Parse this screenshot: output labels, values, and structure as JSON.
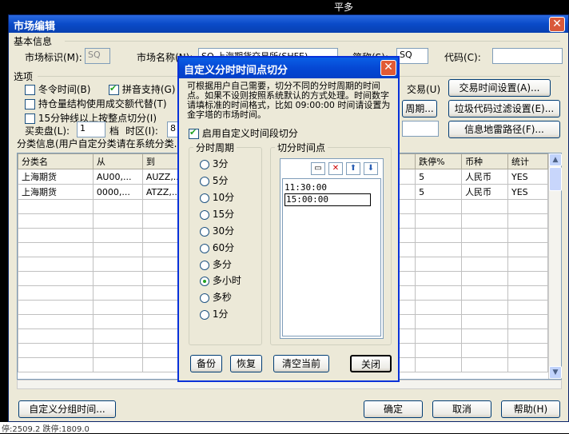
{
  "background": {
    "top_text": "平多",
    "bottom_text": "停:2509.2 跌停:1809.0"
  },
  "window": {
    "title": "市场编辑",
    "close_glyph": "✕",
    "basic_info": {
      "legend": "基本信息",
      "market_id_label": "市场标识(M):",
      "market_id_value": "SQ",
      "market_name_label": "市场名称(N):",
      "market_name_value": "SQ 上海期货交易所(SHFE)",
      "abbr_label": "简称(S):",
      "abbr_value": "SQ",
      "code_label": "代码(C):",
      "code_value": ""
    },
    "options": {
      "legend": "选项",
      "realtime_label": "冬令时间(B)",
      "realtime_checked": false,
      "pinyin_label": "拼音支持(G)",
      "pinyin_checked": true,
      "position_label": "持仓量结构使用成交额代替(T)",
      "position_checked": false,
      "min15_label": "15分钟线以上按整点切分(I)",
      "min15_checked": false,
      "buy_label": "买卖盘(L):",
      "buy_value": "1",
      "level_label": "档",
      "tz_label": "时区(I):",
      "tz_value": "8",
      "trade_label": "交易(U)",
      "trade_time_btn": "交易时间设置(A)...",
      "cycle_btn": "周期...",
      "filter_btn": "垃圾代码过滤设置(E)...",
      "info_btn": "信息地雷路径(F)..."
    },
    "category": {
      "legend": "分类信息(用户自定分类请在系统分类...",
      "columns": [
        "分类名",
        "从",
        "到",
        "",
        "跌停%",
        "币种",
        "统计"
      ],
      "rows": [
        [
          "上海期货",
          "AU00,...",
          "AUZZ,...",
          "",
          "5",
          "人民币",
          "YES"
        ],
        [
          "上海期货",
          "0000,...",
          "ATZZ,...",
          "",
          "5",
          "人民币",
          "YES"
        ]
      ]
    },
    "footer": {
      "custom_group_btn": "自定义分组时间...",
      "ok_btn": "确定",
      "cancel_btn": "取消",
      "help_btn": "帮助(H)"
    }
  },
  "dialog": {
    "title": "自定义分时时间点切分",
    "close_glyph": "✕",
    "description": "可根据用户自己需要，切分不同的分时周期的时间点。如果不设则按照系统默认的方式处理。时间数字请填标准的时间格式，比如 09:00:00 时间请设置为金字塔的市场时间。",
    "enable_label": "启用自定义时间段切分",
    "enable_checked": true,
    "period_legend": "分时周期",
    "periods": [
      {
        "label": "3分",
        "selected": false
      },
      {
        "label": "5分",
        "selected": false
      },
      {
        "label": "10分",
        "selected": false
      },
      {
        "label": "15分",
        "selected": false
      },
      {
        "label": "30分",
        "selected": false
      },
      {
        "label": "60分",
        "selected": false
      },
      {
        "label": "多分",
        "selected": false
      },
      {
        "label": "多小时",
        "selected": true
      },
      {
        "label": "多秒",
        "selected": false
      },
      {
        "label": "1分",
        "selected": false
      }
    ],
    "cut_legend": "切分时间点",
    "time_points": [
      "11:30:00",
      "15:00:00"
    ],
    "buttons": {
      "backup": "备份",
      "restore": "恢复",
      "clear": "清空当前",
      "close": "关闭"
    },
    "accent": "#0831D9"
  }
}
